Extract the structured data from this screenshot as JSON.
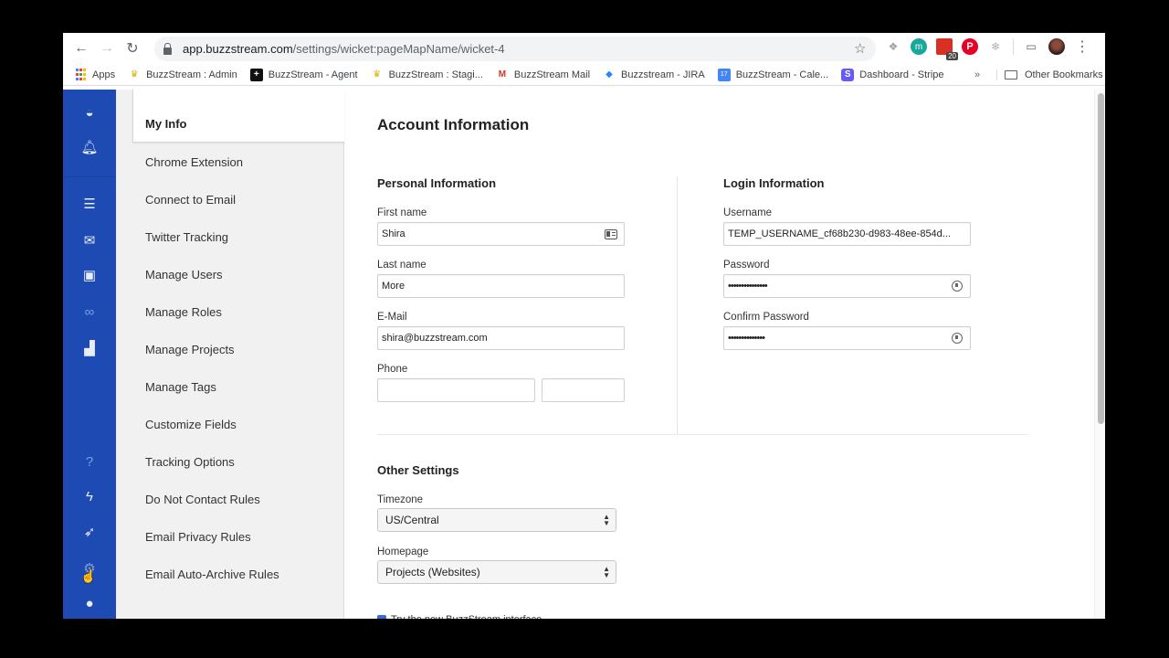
{
  "browser": {
    "url_host": "app.buzzstream.com",
    "url_path": "/settings/wicket:pageMapName/wicket-4",
    "extension_badge": "20",
    "bookmarks": [
      {
        "label": "Apps",
        "icon": "apps-grid-icon"
      },
      {
        "label": "BuzzStream : Admin",
        "icon": "bee-icon"
      },
      {
        "label": "BuzzStream - Agent",
        "icon": "plus-icon"
      },
      {
        "label": "BuzzStream : Stagi...",
        "icon": "bee-icon"
      },
      {
        "label": "BuzzStream Mail",
        "icon": "gmail-icon"
      },
      {
        "label": "Buzzstream - JIRA",
        "icon": "jira-icon"
      },
      {
        "label": "BuzzStream - Cale...",
        "icon": "calendar-icon"
      },
      {
        "label": "Dashboard - Stripe",
        "icon": "stripe-icon"
      }
    ],
    "bookmarks_overflow": "»",
    "other_bookmarks": "Other Bookmarks",
    "calendar_day": "17",
    "stripe_letter": "S"
  },
  "rail": {
    "items": [
      "logo-icon",
      "notifications-icon",
      "list-icon",
      "outreach-icon",
      "contacts-icon",
      "links-icon",
      "reports-icon",
      "help-icon",
      "lightning-icon",
      "rocket-icon",
      "settings-icon",
      "profile-icon"
    ]
  },
  "subnav": {
    "items": [
      {
        "label": "My Info",
        "active": true
      },
      {
        "label": "Chrome Extension"
      },
      {
        "label": "Connect to Email"
      },
      {
        "label": "Twitter Tracking"
      },
      {
        "label": "Manage Users"
      },
      {
        "label": "Manage Roles"
      },
      {
        "label": "Manage Projects"
      },
      {
        "label": "Manage Tags"
      },
      {
        "label": "Customize Fields"
      },
      {
        "label": "Tracking Options"
      },
      {
        "label": "Do Not Contact Rules"
      },
      {
        "label": "Email Privacy Rules"
      },
      {
        "label": "Email Auto-Archive Rules"
      }
    ]
  },
  "main": {
    "title": "Account Information",
    "personal": {
      "title": "Personal Information",
      "first_name_label": "First name",
      "first_name_value": "Shira",
      "last_name_label": "Last name",
      "last_name_value": "More",
      "email_label": "E-Mail",
      "email_value": "shira@buzzstream.com",
      "phone_label": "Phone",
      "phone_value": "",
      "phone_ext_value": ""
    },
    "login": {
      "title": "Login Information",
      "username_label": "Username",
      "username_value": "TEMP_USERNAME_cf68b230-d983-48ee-854d...",
      "password_label": "Password",
      "password_value": "•••••••••••••••",
      "confirm_label": "Confirm Password",
      "confirm_value": "••••••••••••••"
    },
    "other": {
      "title": "Other Settings",
      "timezone_label": "Timezone",
      "timezone_value": "US/Central",
      "homepage_label": "Homepage",
      "homepage_value": "Projects (Websites)",
      "new_interface_label": "Try the new BuzzStream interface",
      "new_interface_checked": true
    }
  }
}
